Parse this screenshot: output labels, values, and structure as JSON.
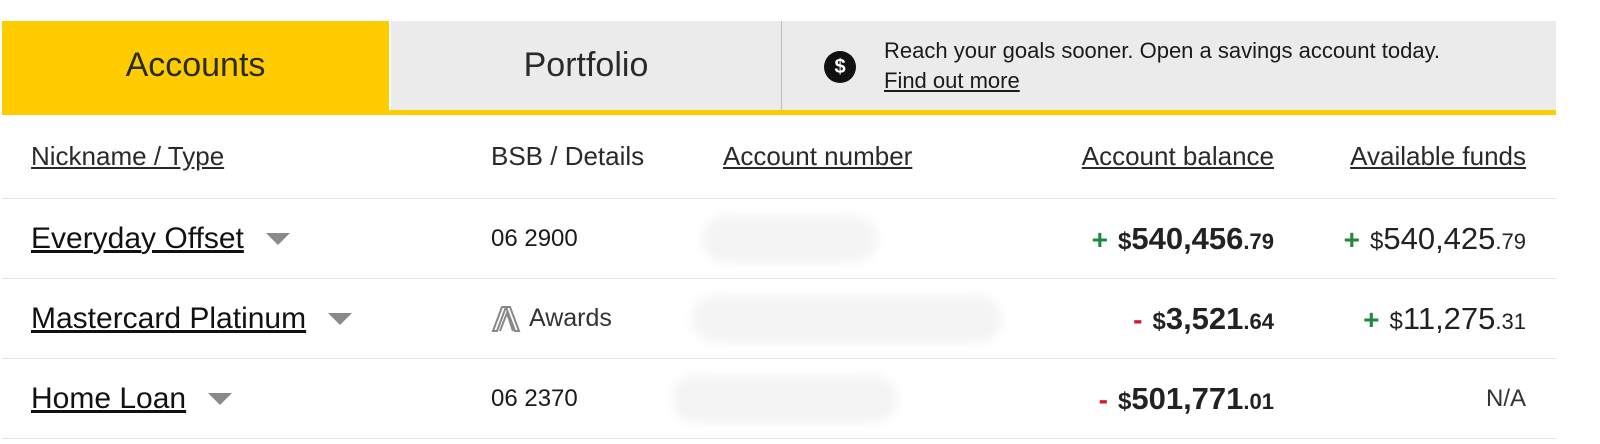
{
  "tabs": {
    "accounts": "Accounts",
    "portfolio": "Portfolio"
  },
  "promo": {
    "icon": "dollar-coin-icon",
    "text": "Reach your goals sooner. Open a savings account today.",
    "link": "Find out more"
  },
  "table": {
    "headers": {
      "name": "Nickname / Type",
      "bsb": "BSB / Details",
      "account_number": "Account number",
      "balance": "Account balance",
      "available": "Available funds"
    },
    "rows": [
      {
        "name": "Everyday Offset",
        "bsb": "06 2900",
        "balance": {
          "sign": "+",
          "dollar": "$",
          "main": "540,456",
          "cents": ".79"
        },
        "available": {
          "sign": "+",
          "dollar": "$",
          "main": "540,425",
          "cents": ".79"
        }
      },
      {
        "name": "Mastercard Platinum",
        "details": "Awards",
        "balance": {
          "sign": "-",
          "dollar": "$",
          "main": "3,521",
          "cents": ".64"
        },
        "available": {
          "sign": "+",
          "dollar": "$",
          "main": "11,275",
          "cents": ".31"
        }
      },
      {
        "name": "Home Loan",
        "bsb": "06 2370",
        "balance": {
          "sign": "-",
          "dollar": "$",
          "main": "501,771",
          "cents": ".01"
        },
        "available": {
          "text": "N/A"
        }
      }
    ]
  },
  "colors": {
    "accent": "#ffcc00",
    "positive": "#1f8a3a",
    "negative": "#d11a2a",
    "tab_inactive": "#ebebeb"
  }
}
